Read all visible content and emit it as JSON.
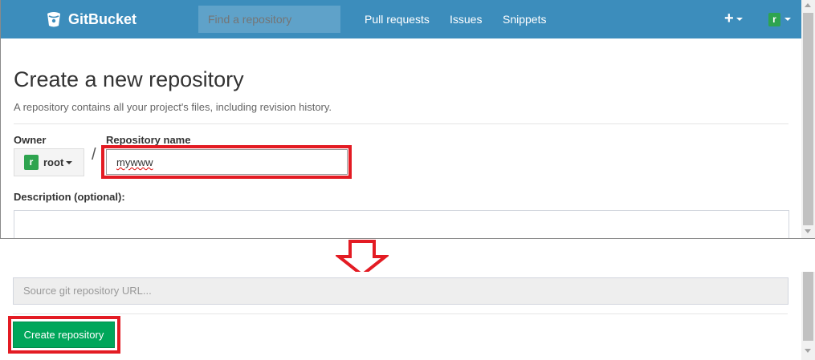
{
  "navbar": {
    "brand": "GitBucket",
    "search_placeholder": "Find a repository",
    "links": [
      "Pull requests",
      "Issues",
      "Snippets"
    ],
    "plus": "+",
    "avatar_letter": "r",
    "color": "#3c8dbc"
  },
  "page": {
    "title": "Create a new repository",
    "subtitle": "A repository contains all your project's files, including revision history."
  },
  "form": {
    "owner_label": "Owner",
    "owner_avatar": "r",
    "owner_name": "root",
    "slash": "/",
    "repo_name_label": "Repository name",
    "repo_name_value": "mywww",
    "description_label": "Description (optional):",
    "source_url_placeholder": "Source git repository URL...",
    "create_button": "Create repository"
  },
  "annotations": {
    "highlight_color": "#e31b23",
    "arrow": "down-arrow"
  }
}
